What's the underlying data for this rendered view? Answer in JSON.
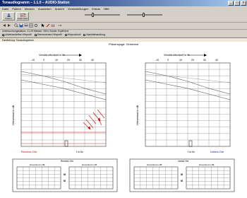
{
  "window": {
    "title": "Tonaudiogramm – 1.1.0 – AUDIO-Station",
    "minimize": "_",
    "maximize": "□",
    "close": "×"
  },
  "menu": [
    "Datei",
    "Patient",
    "Messen",
    "Auswerten",
    "Ansicht",
    "Voreinstellungen",
    "Extras",
    "Hilfe"
  ],
  "toolbar": {
    "buttons": [
      {
        "name": "patient-button",
        "label": "Patient",
        "icon": "patient-icon"
      },
      {
        "name": "audiometer-button",
        "label": "Audiometer",
        "icon": "audiometer-icon"
      }
    ]
  },
  "info_line": "Untersuchungsdatum: 21.09 Messer: 0001  Sonde: Kopfhörer",
  "checkboxes": [
    {
      "label": "Unbehandeltes Hörprofil",
      "checked": true
    },
    {
      "label": "Gemessenes Hörprofil",
      "checked": true
    },
    {
      "label": "Hörprotokoll",
      "checked": false
    },
    {
      "label": "Nachbehandlung",
      "checked": false
    }
  ],
  "tab_label": "Darstellung: Tonaudiogramm",
  "content_title": "Präsenzjagd: Gehörtest",
  "audiogram_left": {
    "top_axis_label": "Verständlichkeit in %",
    "y_axis_label": "Hörverlust in dB",
    "top_ticks": [
      "-10",
      "0",
      "10",
      "20",
      "30",
      "40"
    ],
    "ear_label": "Rechtes Ohr",
    "bottom_label": "f in Hz"
  },
  "audiogram_right": {
    "top_axis_label": "Verständlichkeit in %",
    "y_axis_label": "Hörverlust in dB",
    "top_ticks": [
      "-10",
      "0",
      "10",
      "20",
      "30",
      "40"
    ],
    "ear_label": "Linkes Ohr",
    "bottom_label": "f in Hz"
  },
  "bottom_groups": {
    "left_title": "Rechtes Ohr",
    "right_title": "Linkes Ohr",
    "mini_title": "Hörverlust in dB"
  },
  "colors": {
    "ear_right": "#cc0000",
    "ear_left": "#0000cc",
    "grid": "#333333",
    "titlebar": "#0a246a"
  }
}
